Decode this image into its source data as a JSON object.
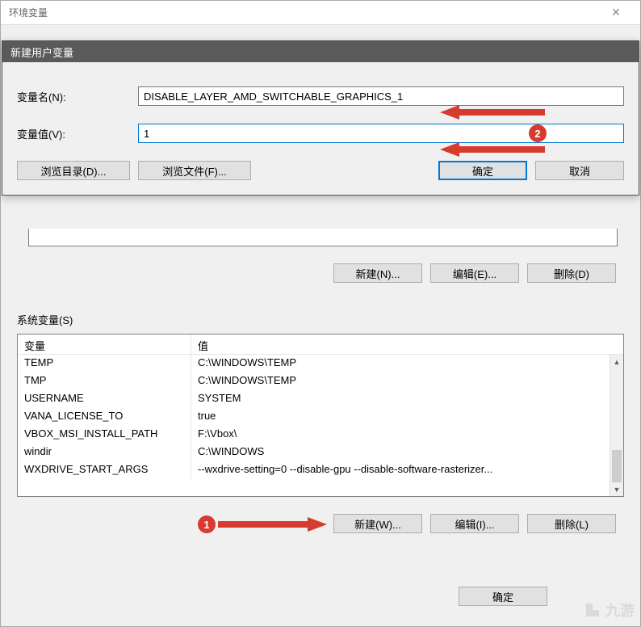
{
  "parent_window": {
    "title": "环境变量",
    "close_glyph": "✕"
  },
  "child_window": {
    "title": "新建用户变量",
    "labels": {
      "var_name": "变量名(N):",
      "var_value": "变量值(V):"
    },
    "values": {
      "var_name": "DISABLE_LAYER_AMD_SWITCHABLE_GRAPHICS_1",
      "var_value": "1"
    },
    "buttons": {
      "browse_dir": "浏览目录(D)...",
      "browse_file": "浏览文件(F)...",
      "ok": "确定",
      "cancel": "取消"
    }
  },
  "user_section": {
    "buttons": {
      "new": "新建(N)...",
      "edit": "编辑(E)...",
      "delete": "删除(D)"
    }
  },
  "sys_section": {
    "label": "系统变量(S)",
    "headers": {
      "variable": "变量",
      "value": "值"
    },
    "rows": [
      {
        "var": "TEMP",
        "val": "C:\\WINDOWS\\TEMP"
      },
      {
        "var": "TMP",
        "val": "C:\\WINDOWS\\TEMP"
      },
      {
        "var": "USERNAME",
        "val": "SYSTEM"
      },
      {
        "var": "VANA_LICENSE_TO",
        "val": "true"
      },
      {
        "var": "VBOX_MSI_INSTALL_PATH",
        "val": "F:\\Vbox\\"
      },
      {
        "var": "windir",
        "val": "C:\\WINDOWS"
      },
      {
        "var": "WXDRIVE_START_ARGS",
        "val": "--wxdrive-setting=0 --disable-gpu --disable-software-rasterizer..."
      }
    ],
    "buttons": {
      "new": "新建(W)...",
      "edit": "编辑(I)...",
      "delete": "删除(L)"
    }
  },
  "final_ok": "确定",
  "annotations": {
    "badge1": "1",
    "badge2": "2"
  },
  "watermark": "九游"
}
